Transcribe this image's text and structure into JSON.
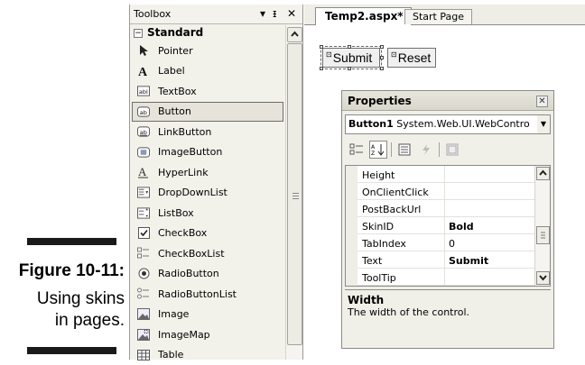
{
  "figure": {
    "number": "Figure 10-11:",
    "caption_lines": [
      "Using skins",
      "in pages."
    ]
  },
  "toolbox": {
    "title": "Toolbox",
    "controls": {
      "dropdown": "▾",
      "pin": "ᵻ",
      "close": "✕"
    },
    "section": {
      "label": "Standard",
      "toggle": "−"
    },
    "items": [
      {
        "label": "Pointer",
        "icon": "pointer-icon"
      },
      {
        "label": "Label",
        "icon": "label-icon"
      },
      {
        "label": "TextBox",
        "icon": "textbox-icon"
      },
      {
        "label": "Button",
        "icon": "button-icon",
        "selected": true
      },
      {
        "label": "LinkButton",
        "icon": "linkbutton-icon"
      },
      {
        "label": "ImageButton",
        "icon": "imagebutton-icon"
      },
      {
        "label": "HyperLink",
        "icon": "hyperlink-icon"
      },
      {
        "label": "DropDownList",
        "icon": "dropdownlist-icon"
      },
      {
        "label": "ListBox",
        "icon": "listbox-icon"
      },
      {
        "label": "CheckBox",
        "icon": "checkbox-icon"
      },
      {
        "label": "CheckBoxList",
        "icon": "checkboxlist-icon"
      },
      {
        "label": "RadioButton",
        "icon": "radiobutton-icon"
      },
      {
        "label": "RadioButtonList",
        "icon": "radiobuttonlist-icon"
      },
      {
        "label": "Image",
        "icon": "image-icon"
      },
      {
        "label": "ImageMap",
        "icon": "imagemap-icon"
      },
      {
        "label": "Table",
        "icon": "table-icon"
      }
    ]
  },
  "tabs": [
    {
      "label": "Temp2.aspx*",
      "active": true
    },
    {
      "label": "Start Page",
      "active": false
    }
  ],
  "designer": {
    "buttons": [
      {
        "label": "Submit",
        "glyph": "⊡"
      },
      {
        "label": "Reset",
        "glyph": "⊡"
      }
    ]
  },
  "properties": {
    "title": "Properties",
    "close": "✕",
    "object_name": "Button1",
    "object_type": "System.Web.UI.WebContro",
    "rows": [
      {
        "name": "Height",
        "value": ""
      },
      {
        "name": "OnClientClick",
        "value": ""
      },
      {
        "name": "PostBackUrl",
        "value": ""
      },
      {
        "name": "SkinID",
        "value": "Bold",
        "bold": true
      },
      {
        "name": "TabIndex",
        "value": "0"
      },
      {
        "name": "Text",
        "value": "Submit",
        "bold": true
      },
      {
        "name": "ToolTip",
        "value": ""
      }
    ],
    "description": {
      "title": "Width",
      "text": "The width of the control."
    }
  },
  "colors": {
    "toolbox_bg": "#f2f1ea",
    "caption_bar": "#1a1a1a",
    "selection_border": "#6e6e6e"
  }
}
